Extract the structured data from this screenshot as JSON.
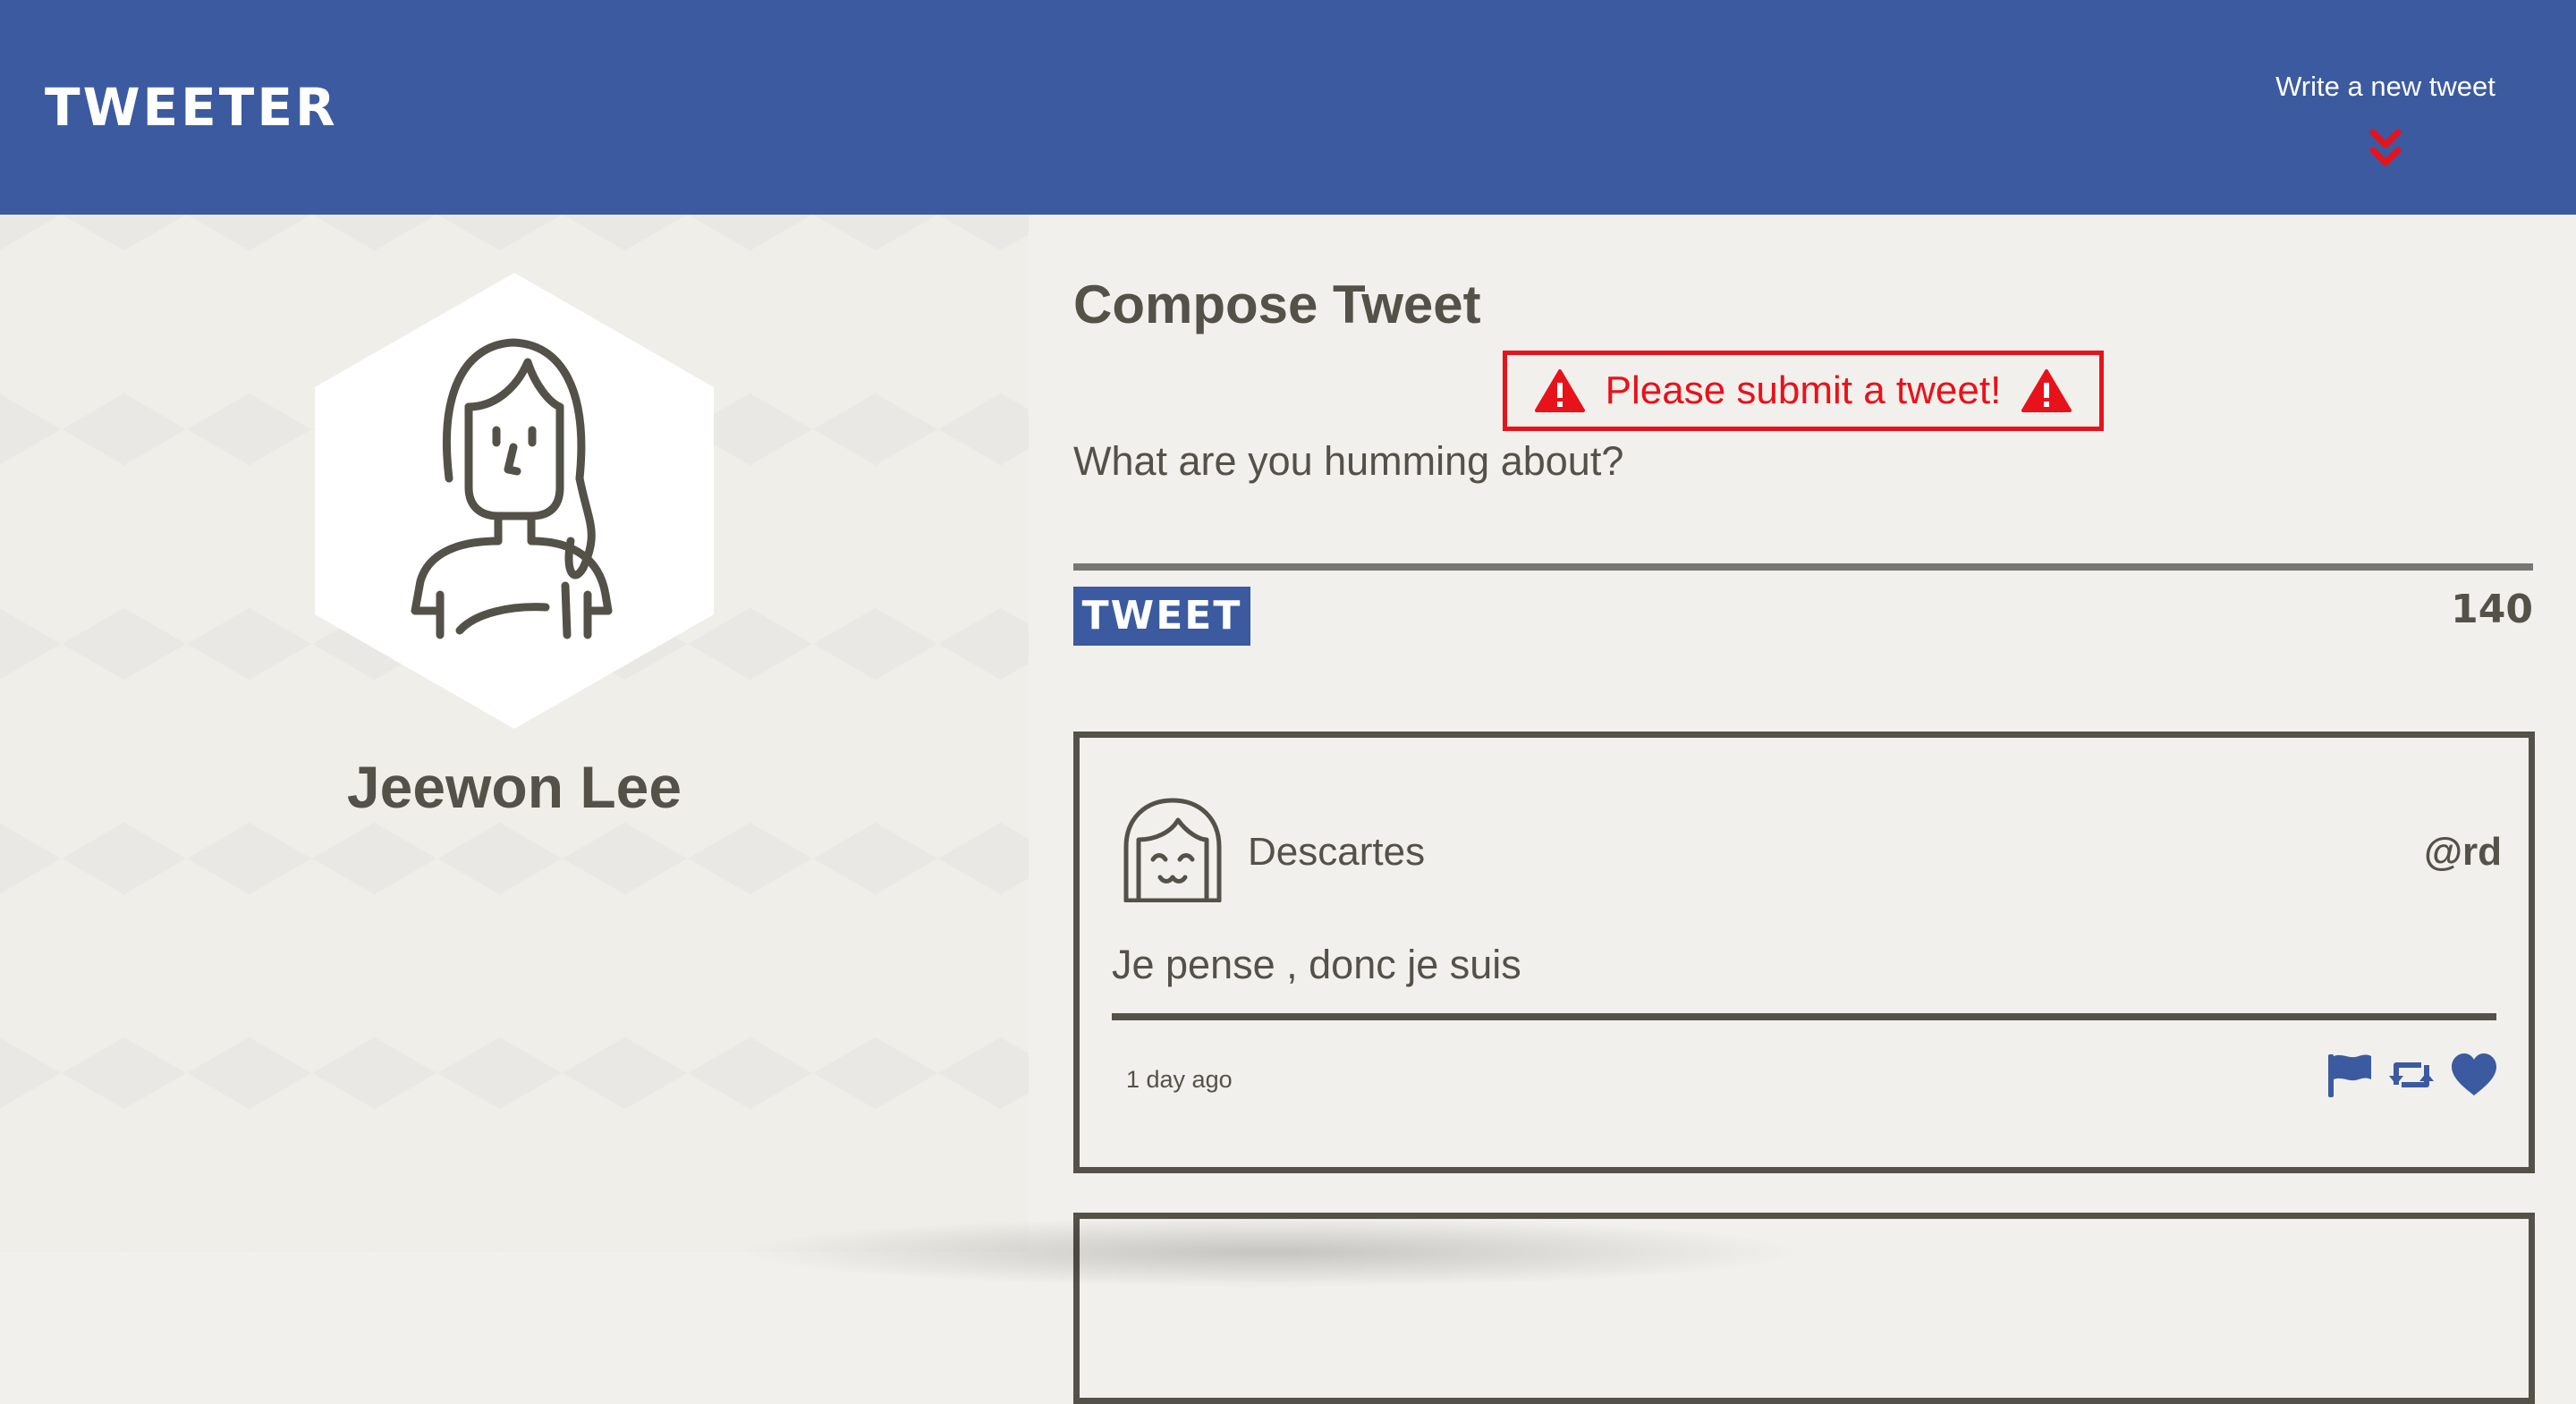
{
  "nav": {
    "brand": "TWEETER",
    "compose_link": "Write a new tweet",
    "compose_icon": "double-chevron-down-icon",
    "background": "#3b5aa0",
    "chevron_color": "#e8121a"
  },
  "profile": {
    "name": "Jeewon Lee",
    "avatar_icon": "user-avatar-icon"
  },
  "compose": {
    "title": "Compose Tweet",
    "error_message": "Please submit a tweet!",
    "error_icon": "warning-triangle-icon",
    "placeholder": "What are you humming about?",
    "value": "",
    "button_label": "TWEET",
    "char_counter": "140",
    "error_color": "#e8121a"
  },
  "tweets": [
    {
      "author": "Descartes",
      "handle": "@rd",
      "content": "Je pense , donc je suis",
      "time": "1 day ago",
      "avatar_icon": "user-avatar-icon",
      "actions": [
        "flag-icon",
        "retweet-icon",
        "heart-icon"
      ]
    }
  ],
  "colors": {
    "primary": "#3b5aa0",
    "text": "#545149",
    "background": "#f1f0ec",
    "error": "#e8121a"
  }
}
